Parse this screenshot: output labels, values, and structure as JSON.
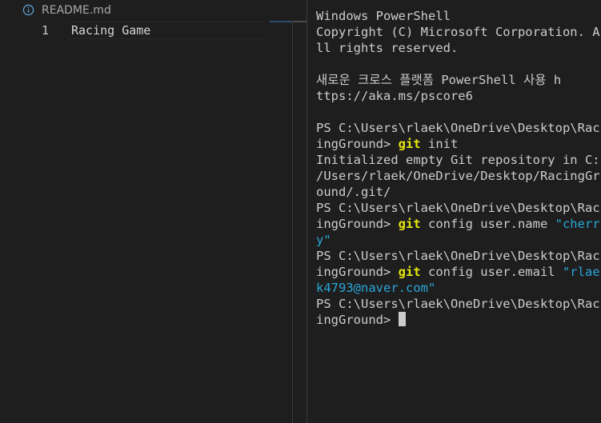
{
  "editor": {
    "tab_title": "README.md",
    "lines": [
      {
        "number": "1",
        "text": "Racing Game"
      }
    ]
  },
  "terminal": {
    "header": {
      "line1": "Windows PowerShell",
      "line2": "Copyright (C) Microsoft Corporation. A",
      "line3": "ll rights reserved."
    },
    "promo": {
      "line1": "새로운 크로스 플랫폼 PowerShell 사용 h",
      "line2": "ttps://aka.ms/pscore6"
    },
    "prompt_line1": "PS C:\\Users\\rlaek\\OneDrive\\Desktop\\Rac",
    "prompt_line2": "ingGround> ",
    "git": "git",
    "cmd_init_args": " init",
    "init_output": {
      "line1": "Initialized empty Git repository in C:",
      "line2": "/Users/rlaek/OneDrive/Desktop/RacingGr",
      "line3": "ound/.git/"
    },
    "cmd_name_args": " config user.name ",
    "cmd_name_value_part1": "\"cherr",
    "cmd_name_value_part2": "y\"",
    "cmd_email_args": " config user.email ",
    "cmd_email_value_part1": "\"rlae",
    "cmd_email_value_part2": "k4793@naver.com\""
  },
  "colors": {
    "background": "#1e1e1e",
    "text": "#cccccc",
    "command": "#e5e510",
    "string": "#2aa6d8"
  },
  "icons": {
    "tab_icon": "info-icon",
    "cursor": "terminal-cursor"
  }
}
